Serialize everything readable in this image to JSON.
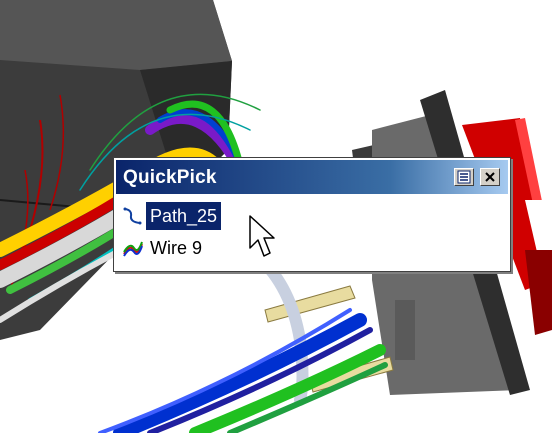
{
  "quickpick": {
    "title": "QuickPick",
    "items": [
      {
        "label": "Path_25",
        "icon": "path-icon",
        "selected": true
      },
      {
        "label": "Wire 9",
        "icon": "wire-icon",
        "selected": false
      }
    ]
  },
  "colors": {
    "title_bar_start": "#0a246a",
    "title_bar_end": "#a6caf0",
    "selection_bg": "#0a246a"
  }
}
